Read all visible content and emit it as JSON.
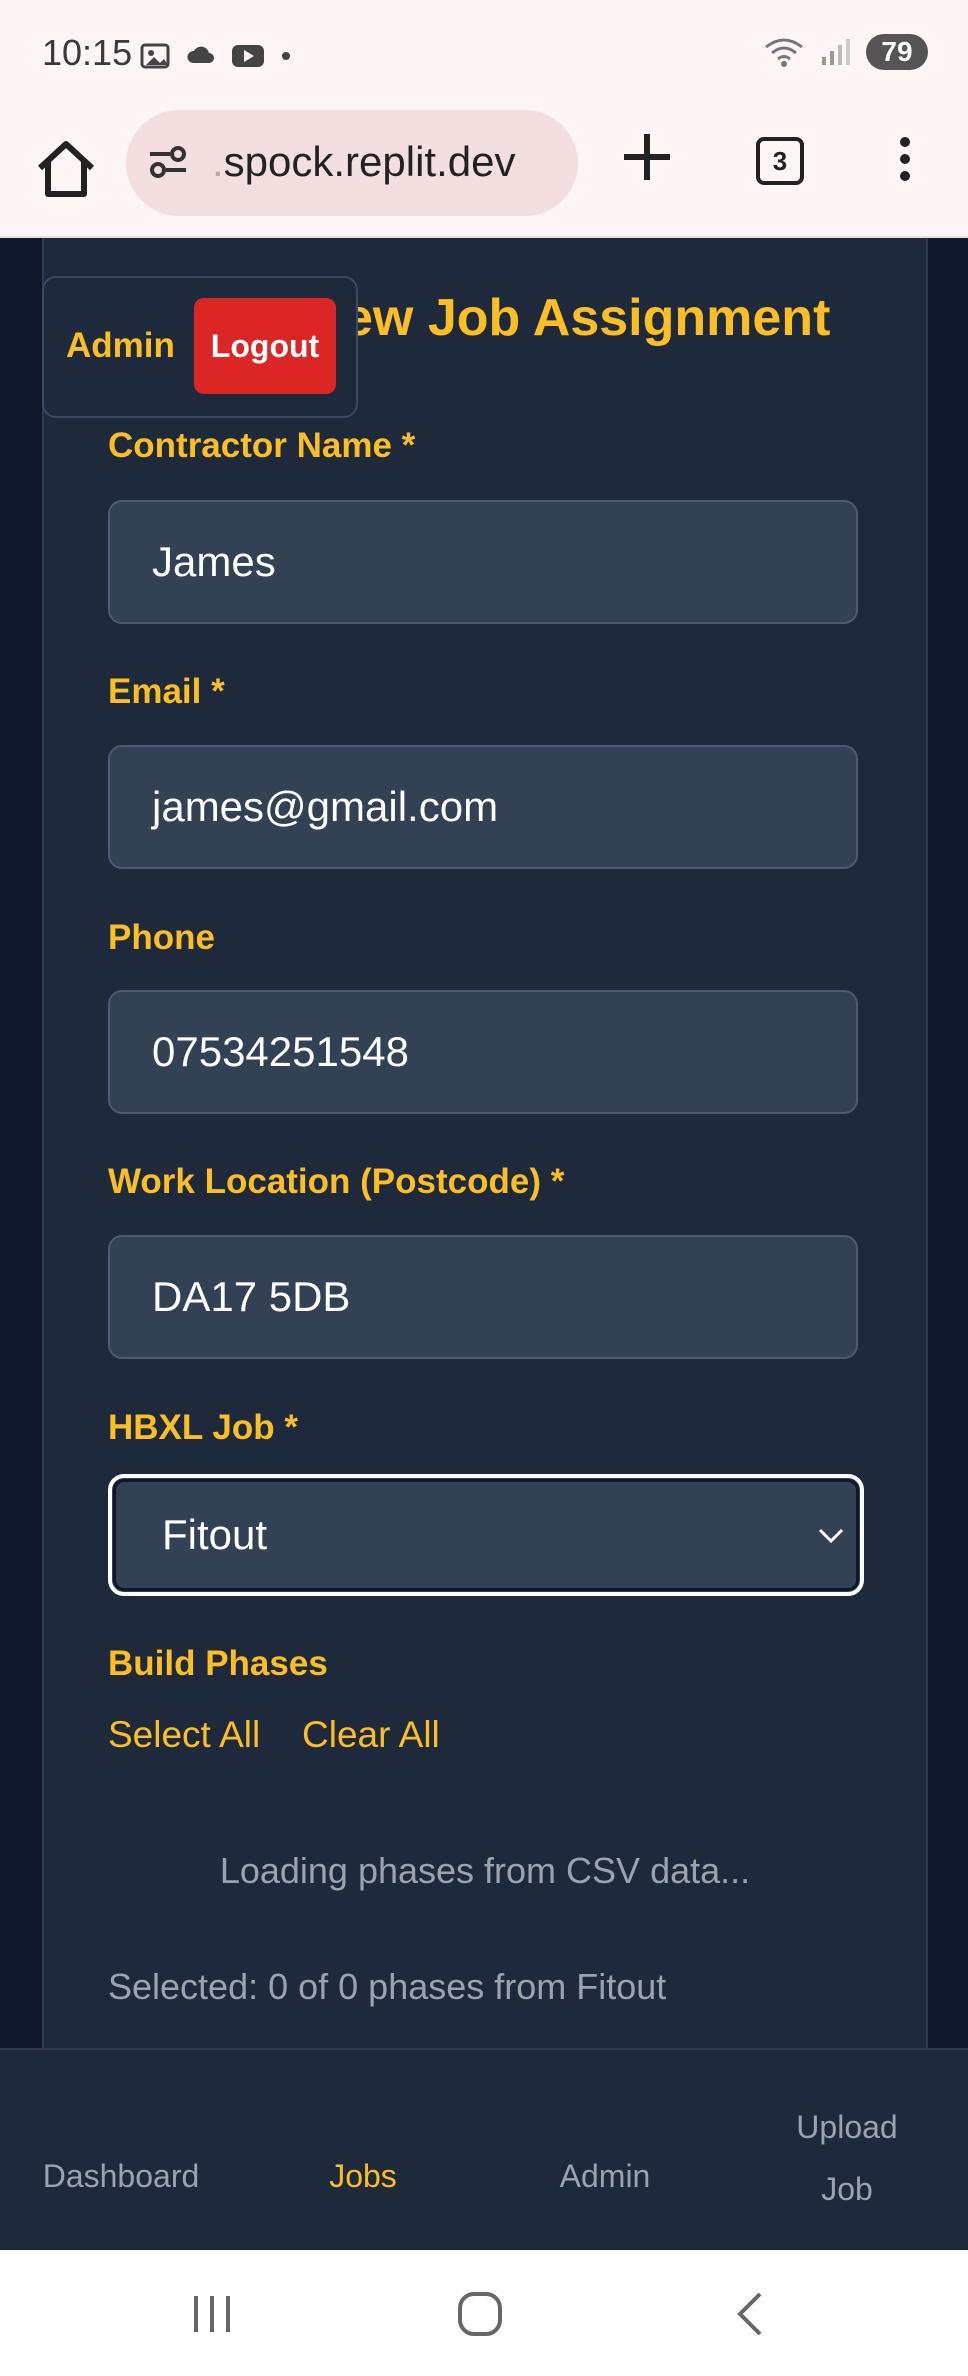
{
  "status_bar": {
    "time": "10:15",
    "battery": "79"
  },
  "browser": {
    "url_prefix": ".",
    "url": "spock.replit.dev",
    "tab_count": "3"
  },
  "form": {
    "title": "ew Job Assignment",
    "fields": {
      "contractor_name": {
        "label": "Contractor Name *",
        "value": "James"
      },
      "email": {
        "label": "Email *",
        "value": "james@gmail.com"
      },
      "phone": {
        "label": "Phone",
        "value": "07534251548"
      },
      "postcode": {
        "label": "Work Location (Postcode) *",
        "value": "DA17 5DB"
      },
      "hbxl_job": {
        "label": "HBXL Job *",
        "selected": "Fitout"
      }
    },
    "build_phases": {
      "label": "Build Phases",
      "select_all": "Select All",
      "clear_all": "Clear All",
      "loading_text": "Loading phases from CSV data...",
      "summary": "Selected: 0 of 0 phases from Fitout"
    }
  },
  "admin_chip": {
    "label": "Admin",
    "logout": "Logout",
    "logout_color": "#dc2626"
  },
  "bottom_nav": {
    "items": [
      {
        "label": "Dashboard",
        "active": false
      },
      {
        "label": "Jobs",
        "active": true
      },
      {
        "label": "Admin",
        "active": false
      },
      {
        "label_line1": "Upload",
        "label_line2": "Job",
        "active": false
      }
    ]
  },
  "colors": {
    "accent": "#fbbf24",
    "card": "#1e293b",
    "input": "#334155",
    "page_bg": "#0f172a"
  },
  "icons": [
    "home-icon",
    "site-settings-icon",
    "plus-icon",
    "tabs-icon",
    "overflow-menu-icon",
    "chevron-down-icon",
    "recents-icon",
    "home-nav-icon",
    "back-icon"
  ]
}
